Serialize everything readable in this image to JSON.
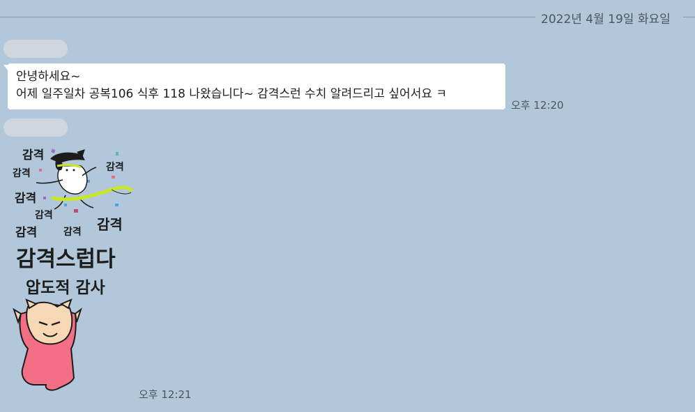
{
  "chat": {
    "date_divider": "2022년 4월 19일 화요일",
    "messages": [
      {
        "lines": [
          "안녕하세요~",
          "어제 일주일차 공복106 식후 118 나왔습니다~ 감격스런 수치 알려드리고 싶어서요 ㅋ"
        ],
        "time": "오후 12:20"
      }
    ],
    "sticker": {
      "small_words": [
        "감격",
        "감격",
        "감격",
        "감격",
        "감격",
        "감격",
        "감격",
        "감격"
      ],
      "headline": "감격스럽다",
      "subline": "압도적 감사",
      "time": "오후 12:21"
    }
  },
  "colors": {
    "background": "#b2c7da",
    "bubble": "#ffffff",
    "character_pink": "#f36f86",
    "ribbon": "#c8e62a"
  }
}
